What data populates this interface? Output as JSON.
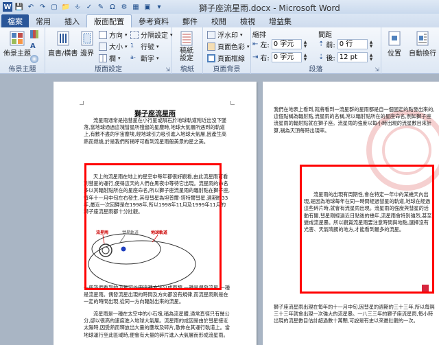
{
  "window": {
    "title": "獅子座流星雨.docx - Microsoft Word"
  },
  "tabs": {
    "file": "檔案",
    "items": [
      "常用",
      "插入",
      "版面配置",
      "參考資料",
      "郵件",
      "校閱",
      "檢視",
      "增益集"
    ],
    "active_index": 2
  },
  "ribbon": {
    "themes": {
      "button": "佈景主題",
      "group_label": "佈景主題"
    },
    "page_setup": {
      "margins": "邊界",
      "orientation_text": "直書/橫書",
      "orientation": "方向",
      "size": "大小",
      "columns": "欄",
      "breaks": "分隔設定",
      "line_numbers": "行號",
      "hyphenation": "斷字",
      "group_label": "版面設定"
    },
    "manuscript": {
      "button": "稿紙設定",
      "group_label": "稿紙"
    },
    "page_background": {
      "watermark": "浮水印",
      "page_color": "頁面色彩",
      "page_borders": "頁面框線",
      "group_label": "頁面背景"
    },
    "paragraph": {
      "indent_title": "縮排",
      "spacing_title": "間距",
      "left_label": "左:",
      "left_value": "0 字元",
      "right_label": "右:",
      "right_value": "0 字元",
      "before_label": "前:",
      "before_value": "0 行",
      "after_label": "後:",
      "after_value": "12 pt",
      "group_label": "段落"
    },
    "arrange": {
      "position": "位置",
      "wrap": "自動換行"
    }
  },
  "document": {
    "page1": {
      "title": "獅子座流星雨",
      "para1": "流星雨通常是指彗星在小行星或隕石於地球軌道附近出沒下墜落,當地球通過這塊彗星所殘留的星塵時,地球大氣層所遇到的軌道上,有數不盡的宇宙塵埃,經地球引力吸引進入地球大氣層,因產生高熱而燃燒,於是我們所稱呼可看到流星雨般美景的星之美。",
      "para2": "天上的流星雨在地上的星空中每年都很好觀看,由此流星雨可看到彗星的運行,使得這天的人們在黑夜中等待它出現。流星雨的命名多以其輻射點所在的星座命名,所以獅子座流星雨的輻射點在獅子座,每年十一月中旬左右發生,其母彗星為坦普爾-塔特爾彗星,週期約33年,最近一次回歸是在1998年,所以1998年11月及1999年11月的獅子座流星雨都十分壯觀。",
      "labels": {
        "meteor": "流星雨",
        "comet": "彗星軌道",
        "earth": "地球軌道"
      },
      "para3": "一般我們看到的流星可以用這種方法分成兩類,一種是偶發流星,一種是流星雨。偶發流星出現的時間及方向都沒有規律,而流星雨則是在一定的時間出現,從同一方向輻射出來的流星。",
      "para4": "流星雨是一種在太空中的小石塊,稱為流星體,通常直徑只有幾公分,卻以很高的速度進入地球大氣層。流星雨的成因是由於彗星接近太陽時,因受熱而釋放出大量的塵埃及碎片,散佈在其運行軌道上。當地球運行至此區域時,便會有大量的碎片進入大氣層而形成流星雨。"
    },
    "page2": {
      "para1": "我們在地表上看到,就將看到一流星群的星雨都是自一個固定的點發出來的,這個點稱為輻射點,流星雨的名稱,常以輻射點所在的星座命名,例如獅子座流星雨的輻射點就在獅子座。流星雨的強度以每小時出現的流星數目來計算,稱為天頂每時出現率。",
      "para2": "流星雨的出現有周期性,會在特定一年中的某幾天內出現,是因為地球每年在同一時間經過彗星的軌道,地球在經過這些碎片時,就會有流星雨出現。流星雨的強度與彗星的活動有關,彗星剛經過近日點後的幾年,流星雨會特別強烈,甚至變成流星暴。所以觀賞流星雨要注意時間與地點,選擇沒有光害、天氣晴朗的地方,才能看到最多的流星。",
      "para3": "獅子座流星雨出現在每年的十一月中旬,因彗星的週期約三十三年,所以每隔三十三年就會出現一次強大的流星暴。一八三三年的獅子座流星雨,每小時出現的流星數目估計超過數十萬顆,可說是有史以來最壯觀的一次。"
    }
  }
}
